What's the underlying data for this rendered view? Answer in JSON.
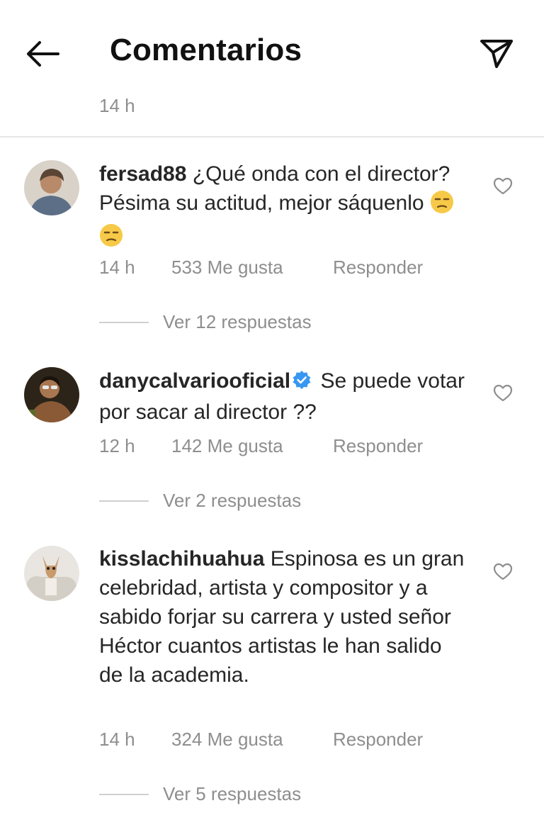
{
  "header": {
    "title": "Comentarios",
    "back_icon": "arrow-left-icon",
    "send_icon": "paper-plane-icon"
  },
  "top_time": "14 h",
  "comments": [
    {
      "username": "fersad88",
      "text": "¿Qué onda con el director? Pésima su actitud, mejor sáquenlo",
      "emojis": [
        "unamused-face",
        "unamused-face"
      ],
      "time": "14 h",
      "likes": "533 Me gusta",
      "reply": "Responder",
      "view_replies": "Ver 12 respuestas"
    },
    {
      "username": "danycalvariooficial",
      "verified": true,
      "text": "Se puede votar por sacar al director ??",
      "time": "12 h",
      "likes": "142 Me gusta",
      "reply": "Responder",
      "view_replies": "Ver 2 respuestas"
    },
    {
      "username": "kisslachihuahua",
      "text": "Espinosa es un gran celebridad, artista y compositor y a sabido forjar su carrera y usted señor Héctor cuantos artistas le han salido de la academia.",
      "time": "14 h",
      "likes": "324 Me gusta",
      "reply": "Responder",
      "view_replies": "Ver 5 respuestas"
    }
  ],
  "colors": {
    "text": "#262626",
    "secondary": "#8e8e8e",
    "verified": "#3897f0",
    "divider": "#e6e6e6"
  }
}
